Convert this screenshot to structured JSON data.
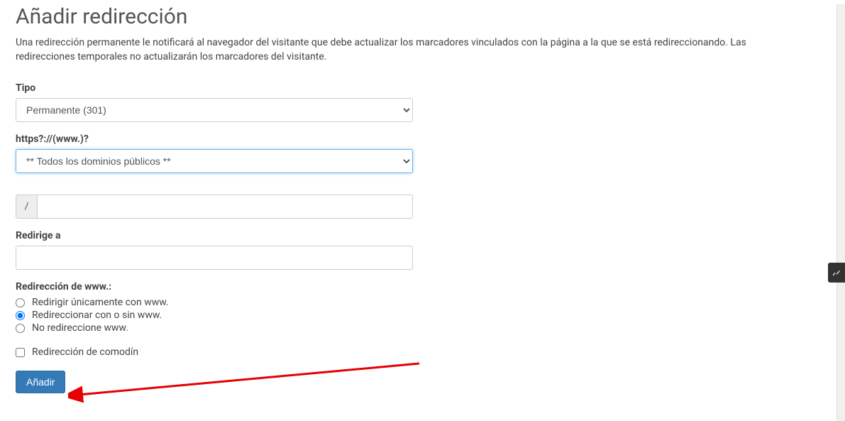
{
  "header": {
    "title": "Añadir redirección",
    "description": "Una redirección permanente le notificará al navegador del visitante que debe actualizar los marcadores vinculados con la página a la que se está redireccionando. Las redirecciones temporales no actualizarán los marcadores del visitante."
  },
  "form": {
    "type_label": "Tipo",
    "type_selected": "Permanente (301)",
    "domain_label": "https?://(www.)?",
    "domain_selected": "** Todos los dominios públicos **",
    "path_prefix": "/",
    "path_value": "",
    "redirect_to_label": "Redirige a",
    "redirect_to_value": "",
    "www_redirect_label": "Redirección de www.:",
    "www_options": {
      "only_www": "Redirigir únicamente con www.",
      "with_or_without": "Redireccionar con o sin www.",
      "no_redirect": "No redireccione www."
    },
    "wildcard_label": "Redirección de comodín",
    "submit_label": "Añadir"
  },
  "annotation": {
    "arrow_color": "#e60000"
  },
  "colors": {
    "primary": "#337ab7"
  }
}
